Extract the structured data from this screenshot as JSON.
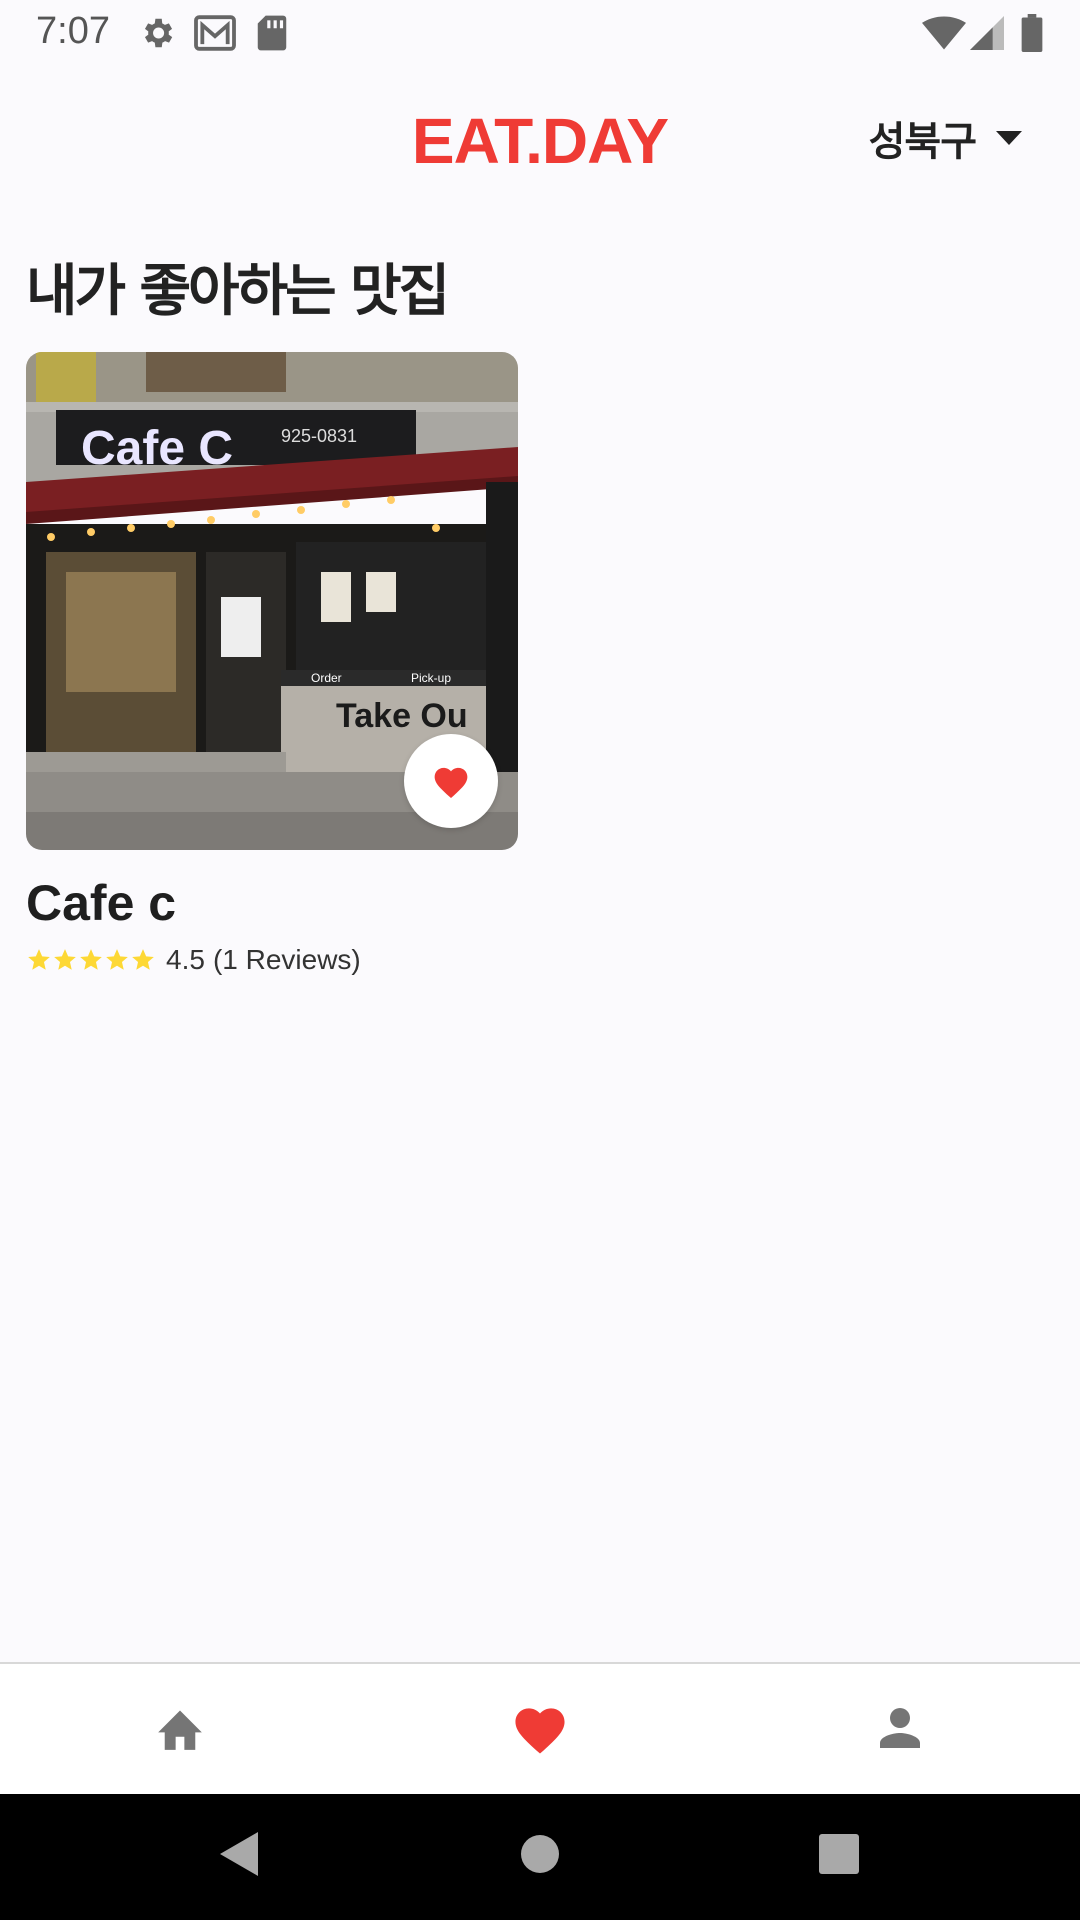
{
  "status_bar": {
    "time": "7:07",
    "icons": [
      "gear-icon",
      "gmail-icon",
      "sd-card-icon",
      "wifi-icon",
      "signal-icon",
      "battery-icon"
    ]
  },
  "header": {
    "brand": "EAT.DAY",
    "district": "성북구",
    "brand_color": "#ef3b35"
  },
  "page": {
    "title": "내가 좋아하는 맛집"
  },
  "favorites": [
    {
      "name": "Cafe c",
      "rating": "4.5",
      "reviews_text": "(1 Reviews)",
      "stars": 5,
      "favorited": true,
      "sign_text": "Cafe C",
      "phone_text": "925-0831",
      "window_text_1": "Order",
      "window_text_2": "Pick-up",
      "takeout_text": "Take Ou"
    }
  ],
  "bottom_nav": {
    "items": [
      {
        "name": "home",
        "icon": "home-icon",
        "active": false
      },
      {
        "name": "favorites",
        "icon": "heart-icon",
        "active": true
      },
      {
        "name": "profile",
        "icon": "person-icon",
        "active": false
      }
    ],
    "active_color": "#ef3b35",
    "inactive_color": "#757575"
  },
  "colors": {
    "accent": "#ef3b35",
    "star": "#fdd835",
    "background": "#fbfafd"
  }
}
